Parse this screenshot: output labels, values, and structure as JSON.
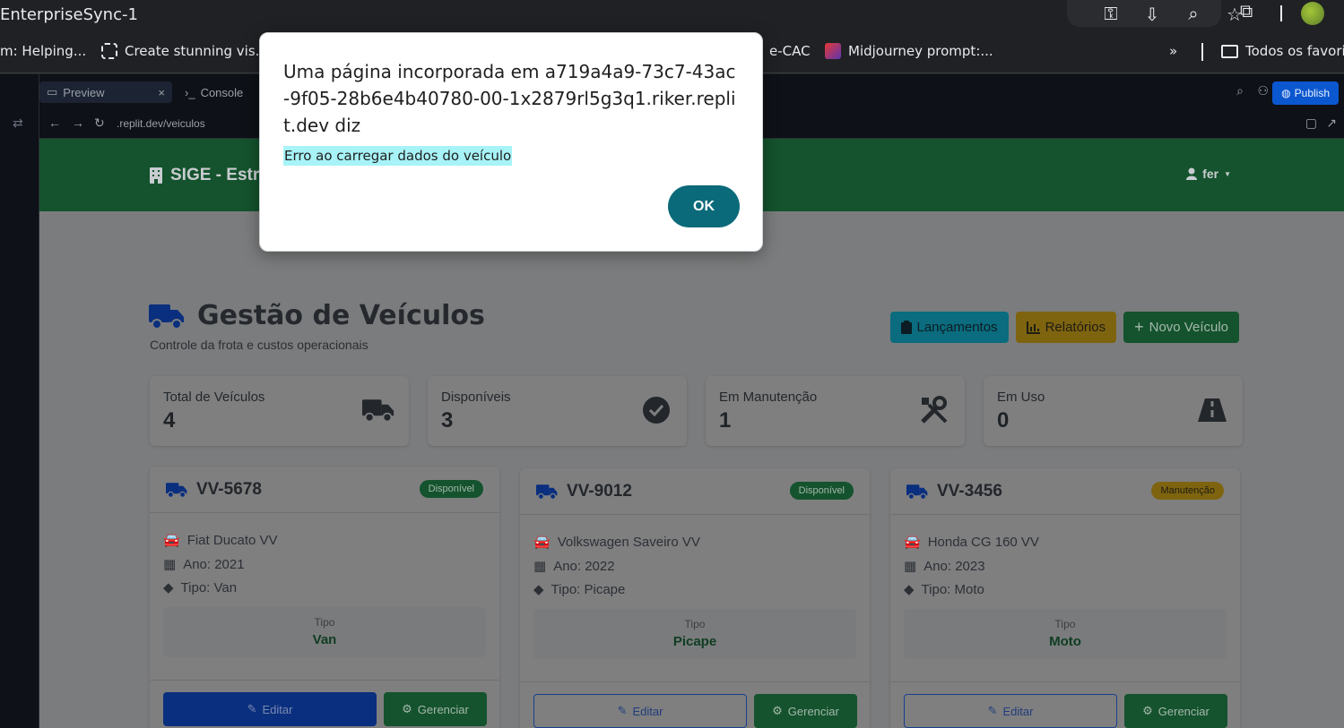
{
  "window": {
    "title": "EnterpriseSync-1"
  },
  "bookmarks": [
    {
      "label": "m: Helping..."
    },
    {
      "label": "Create stunning vis..."
    },
    {
      "label": "e-CAC"
    },
    {
      "label": "Midjourney prompt:..."
    },
    {
      "label": "Todos os favoritos"
    }
  ],
  "bookmarks_more": "»",
  "replit": {
    "tabs": [
      {
        "label": "Preview"
      },
      {
        "label": "Console"
      }
    ],
    "publish_label": "Publish",
    "url": ".replit.dev/veiculos"
  },
  "app": {
    "brand": "SIGE - Estru",
    "user": "fer",
    "page_title": "Gestão de Veículos",
    "page_subtitle": "Controle da frota e custos operacionais",
    "actions": {
      "lancamentos": "Lançamentos",
      "relatorios": "Relatórios",
      "novo": "Novo Veículo"
    },
    "stats": [
      {
        "label": "Total de Veículos",
        "value": "4",
        "icon": "truck-icon"
      },
      {
        "label": "Disponíveis",
        "value": "3",
        "icon": "check-circle-icon"
      },
      {
        "label": "Em Manutenção",
        "value": "1",
        "icon": "tools-icon"
      },
      {
        "label": "Em Uso",
        "value": "0",
        "icon": "road-icon"
      }
    ],
    "vehicles": [
      {
        "plate": "VV-5678",
        "status": "Disponível",
        "model": "Fiat Ducato VV",
        "ano": "Ano: 2021",
        "tipo": "Tipo: Van",
        "tipo_label": "Tipo",
        "tipo_value": "Van",
        "edit": "Editar",
        "manage": "Gerenciar"
      },
      {
        "plate": "VV-9012",
        "status": "Disponível",
        "model": "Volkswagen Saveiro VV",
        "ano": "Ano: 2022",
        "tipo": "Tipo: Picape",
        "tipo_label": "Tipo",
        "tipo_value": "Picape",
        "edit": "Editar",
        "manage": "Gerenciar"
      },
      {
        "plate": "VV-3456",
        "status": "Manutenção",
        "model": "Honda CG 160 VV",
        "ano": "Ano: 2023",
        "tipo": "Tipo: Moto",
        "tipo_label": "Tipo",
        "tipo_value": "Moto",
        "edit": "Editar",
        "manage": "Gerenciar"
      }
    ]
  },
  "dialog": {
    "title": "Uma página incorporada em a719a4a9-73c7-43ac-9f05-28b6e4b40780-00-1x2879rl5g3q1.riker.replit.dev diz",
    "message": "Erro ao carregar dados do veículo",
    "ok": "OK"
  },
  "colors": {
    "navbar": "#14532d",
    "info": "#0a6c7e",
    "warning": "#7f6410",
    "primary": "#0a2f7e",
    "dialog_ok": "#0b6a7a",
    "highlight": "#a7f3f7"
  }
}
